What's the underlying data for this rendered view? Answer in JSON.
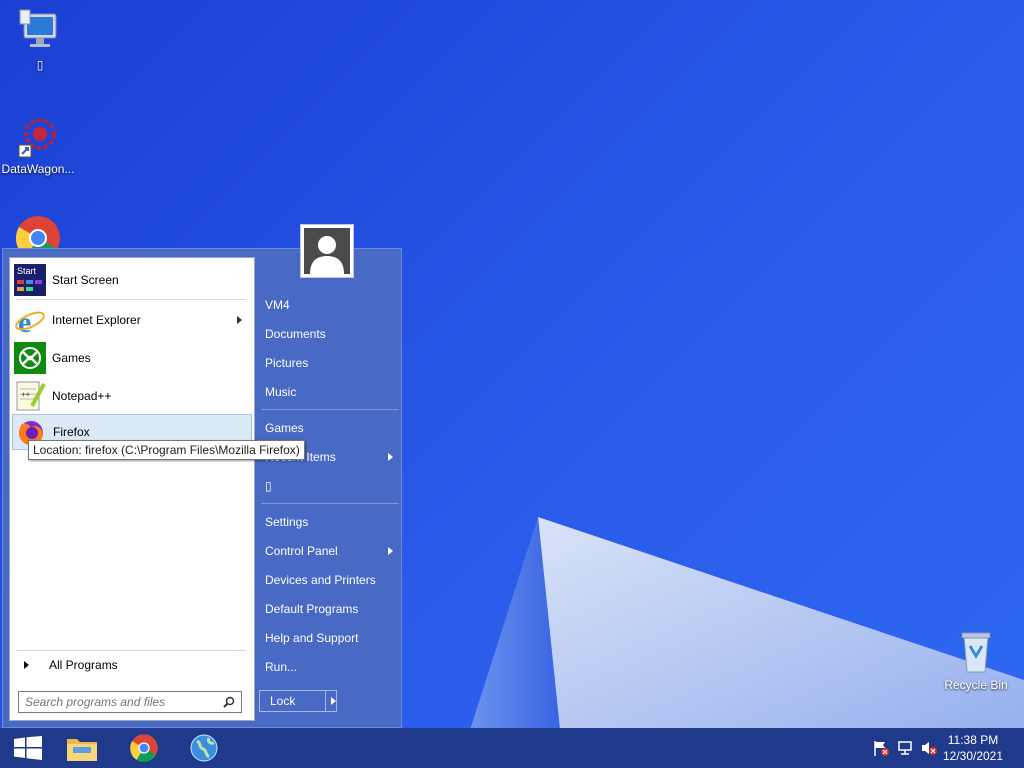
{
  "desktop": {
    "icons": [
      {
        "label": "▯",
        "icon": "computer-icon"
      },
      {
        "label": "DataWagon...",
        "icon": "datawagon-icon"
      },
      {
        "label": "",
        "icon": "chrome-icon"
      },
      {
        "label": "Recycle Bin",
        "icon": "recycle-bin-icon"
      }
    ]
  },
  "start_menu": {
    "left_items": [
      {
        "label": "Start Screen",
        "icon": "start-screen-icon"
      },
      {
        "label": "Internet Explorer",
        "icon": "internet-explorer-icon",
        "submenu": true
      },
      {
        "label": "Games",
        "icon": "games-icon"
      },
      {
        "label": "Notepad++",
        "icon": "notepad-plus-plus-icon"
      },
      {
        "label": "Firefox",
        "icon": "firefox-icon",
        "selected": true
      }
    ],
    "all_programs": "All Programs",
    "search_placeholder": "Search programs and files",
    "tooltip": "Location: firefox (C:\\Program Files\\Mozilla Firefox)",
    "right_items": [
      {
        "label": "VM4"
      },
      {
        "label": "Documents"
      },
      {
        "label": "Pictures"
      },
      {
        "label": "Music"
      },
      {
        "label": "Games"
      },
      {
        "label": "Recent Items",
        "submenu": true
      },
      {
        "label": "▯"
      },
      {
        "label": "Settings"
      },
      {
        "label": "Control Panel",
        "submenu": true
      },
      {
        "label": "Devices and Printers"
      },
      {
        "label": "Default Programs"
      },
      {
        "label": "Help and Support"
      },
      {
        "label": "Run..."
      }
    ],
    "lock_label": "Lock"
  },
  "taskbar": {
    "pinned": [
      "windows-start-icon",
      "file-explorer-icon",
      "chrome-icon",
      "globe-icon"
    ],
    "tray": [
      "action-center-flag-icon",
      "network-icon",
      "volume-muted-icon"
    ],
    "time": "11:38 PM",
    "date": "12/30/2021"
  },
  "colors": {
    "menu_right_bg": "#4869c4",
    "taskbar_bg": "#1f3a8a",
    "selection_bg": "#dbe8f6"
  }
}
